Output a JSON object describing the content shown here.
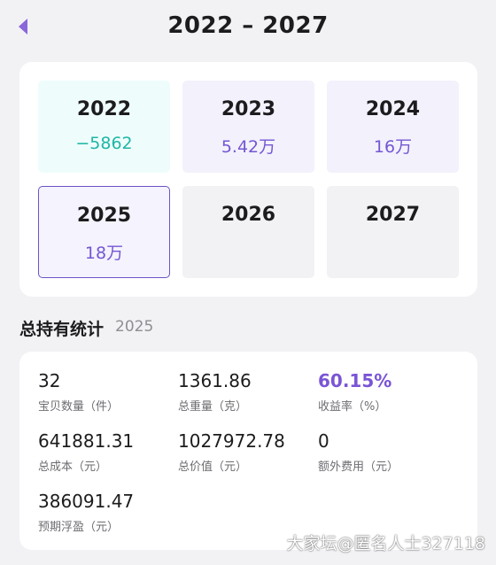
{
  "header": {
    "title": "2022 – 2027"
  },
  "years": [
    {
      "year": "2022",
      "value": "−5862"
    },
    {
      "year": "2023",
      "value": "5.42万"
    },
    {
      "year": "2024",
      "value": "16万"
    },
    {
      "year": "2025",
      "value": "18万"
    },
    {
      "year": "2026",
      "value": ""
    },
    {
      "year": "2027",
      "value": ""
    }
  ],
  "selected_year": "2025",
  "stats_section": {
    "title": "总持有统计",
    "year": "2025",
    "items": [
      {
        "value": "32",
        "label": "宝贝数量（件）"
      },
      {
        "value": "1361.86",
        "label": "总重量（克）"
      },
      {
        "value": "60.15%",
        "label": "收益率（%）"
      },
      {
        "value": "641881.31",
        "label": "总成本（元）"
      },
      {
        "value": "1027972.78",
        "label": "总价值（元）"
      },
      {
        "value": "0",
        "label": "额外费用（元）"
      },
      {
        "value": "386091.47",
        "label": "预期浮盈（元）"
      }
    ]
  },
  "watermark": "大家坛@匿名人士327118",
  "colors": {
    "accent_purple": "#7457d3",
    "negative_teal": "#1fb6a6",
    "background": "#f2f2f5"
  },
  "icons": {
    "back": "back-triangle-icon"
  }
}
